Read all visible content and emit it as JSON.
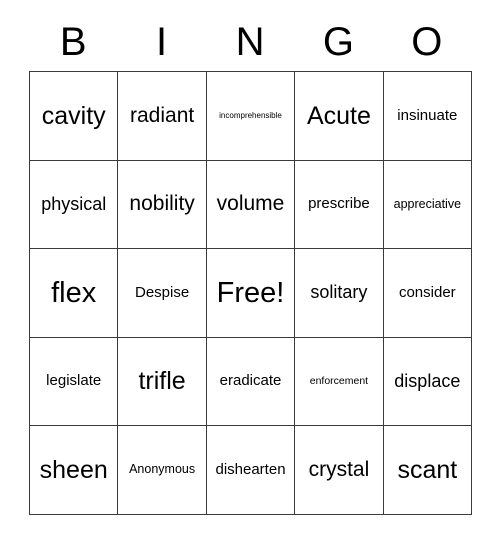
{
  "card": {
    "title": "BINGO",
    "header_letters": [
      "B",
      "I",
      "N",
      "G",
      "O"
    ],
    "free_space_label": "Free!",
    "colors": {
      "border": "#3a3a3a",
      "text": "#000000",
      "background": "#ffffff"
    },
    "grid": {
      "rows": 5,
      "columns": 5,
      "cells": [
        [
          {
            "text": "cavity",
            "size": "xxl"
          },
          {
            "text": "radiant",
            "size": "xl"
          },
          {
            "text": "incomprehensible",
            "size": "xxs"
          },
          {
            "text": "Acute",
            "size": "xxl"
          },
          {
            "text": "insinuate",
            "size": "m"
          }
        ],
        [
          {
            "text": "physical",
            "size": "l"
          },
          {
            "text": "nobility",
            "size": "xl"
          },
          {
            "text": "volume",
            "size": "xl"
          },
          {
            "text": "prescribe",
            "size": "m"
          },
          {
            "text": "appreciative",
            "size": "s"
          }
        ],
        [
          {
            "text": "flex",
            "size": "huge"
          },
          {
            "text": "Despise",
            "size": "m"
          },
          {
            "text": "Free!",
            "size": "huge"
          },
          {
            "text": "solitary",
            "size": "l"
          },
          {
            "text": "consider",
            "size": "m"
          }
        ],
        [
          {
            "text": "legislate",
            "size": "m"
          },
          {
            "text": "trifle",
            "size": "xxl"
          },
          {
            "text": "eradicate",
            "size": "m"
          },
          {
            "text": "enforcement",
            "size": "xs"
          },
          {
            "text": "displace",
            "size": "l"
          }
        ],
        [
          {
            "text": "sheen",
            "size": "xxl"
          },
          {
            "text": "Anonymous",
            "size": "s"
          },
          {
            "text": "dishearten",
            "size": "m"
          },
          {
            "text": "crystal",
            "size": "xl"
          },
          {
            "text": "scant",
            "size": "xxl"
          }
        ]
      ]
    }
  }
}
